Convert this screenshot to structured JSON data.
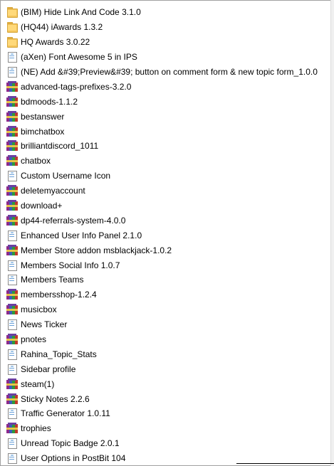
{
  "files": [
    {
      "name": "(BIM) Hide Link And Code 3.1.0",
      "type": "folder"
    },
    {
      "name": "(HQ44) iAwards 1.3.2",
      "type": "folder"
    },
    {
      "name": "HQ Awards 3.0.22",
      "type": "folder"
    },
    {
      "name": "(aXen) Font Awesome 5 in IPS",
      "type": "document"
    },
    {
      "name": "(NE) Add &#39;Preview&#39; button on comment form & new topic form_1.0.0",
      "type": "document"
    },
    {
      "name": "advanced-tags-prefixes-3.2.0",
      "type": "archive"
    },
    {
      "name": "bdmoods-1.1.2",
      "type": "archive"
    },
    {
      "name": "bestanswer",
      "type": "archive"
    },
    {
      "name": "bimchatbox",
      "type": "archive"
    },
    {
      "name": "brilliantdiscord_1011",
      "type": "archive"
    },
    {
      "name": "chatbox",
      "type": "archive"
    },
    {
      "name": "Custom Username Icon",
      "type": "document"
    },
    {
      "name": "deletemyaccount",
      "type": "archive"
    },
    {
      "name": "download+",
      "type": "archive"
    },
    {
      "name": "dp44-referrals-system-4.0.0",
      "type": "archive"
    },
    {
      "name": "Enhanced User Info Panel 2.1.0",
      "type": "document"
    },
    {
      "name": "Member Store addon msblackjack-1.0.2",
      "type": "archive"
    },
    {
      "name": "Members Social Info 1.0.7",
      "type": "document"
    },
    {
      "name": "Members Teams",
      "type": "document"
    },
    {
      "name": "membersshop-1.2.4",
      "type": "archive"
    },
    {
      "name": "musicbox",
      "type": "archive"
    },
    {
      "name": "News Ticker",
      "type": "document"
    },
    {
      "name": "pnotes",
      "type": "archive"
    },
    {
      "name": "Rahina_Topic_Stats",
      "type": "document"
    },
    {
      "name": "Sidebar profile",
      "type": "document"
    },
    {
      "name": "steam(1)",
      "type": "archive"
    },
    {
      "name": "Sticky Notes 2.2.6",
      "type": "archive"
    },
    {
      "name": "Traffic Generator 1.0.11",
      "type": "document"
    },
    {
      "name": "trophies",
      "type": "archive"
    },
    {
      "name": "Unread Topic Badge 2.0.1",
      "type": "document"
    },
    {
      "name": "User Options in PostBit 104",
      "type": "document"
    }
  ],
  "icons": {
    "folder": "folder-icon",
    "document": "document-icon",
    "archive": "rar-archive-icon"
  }
}
